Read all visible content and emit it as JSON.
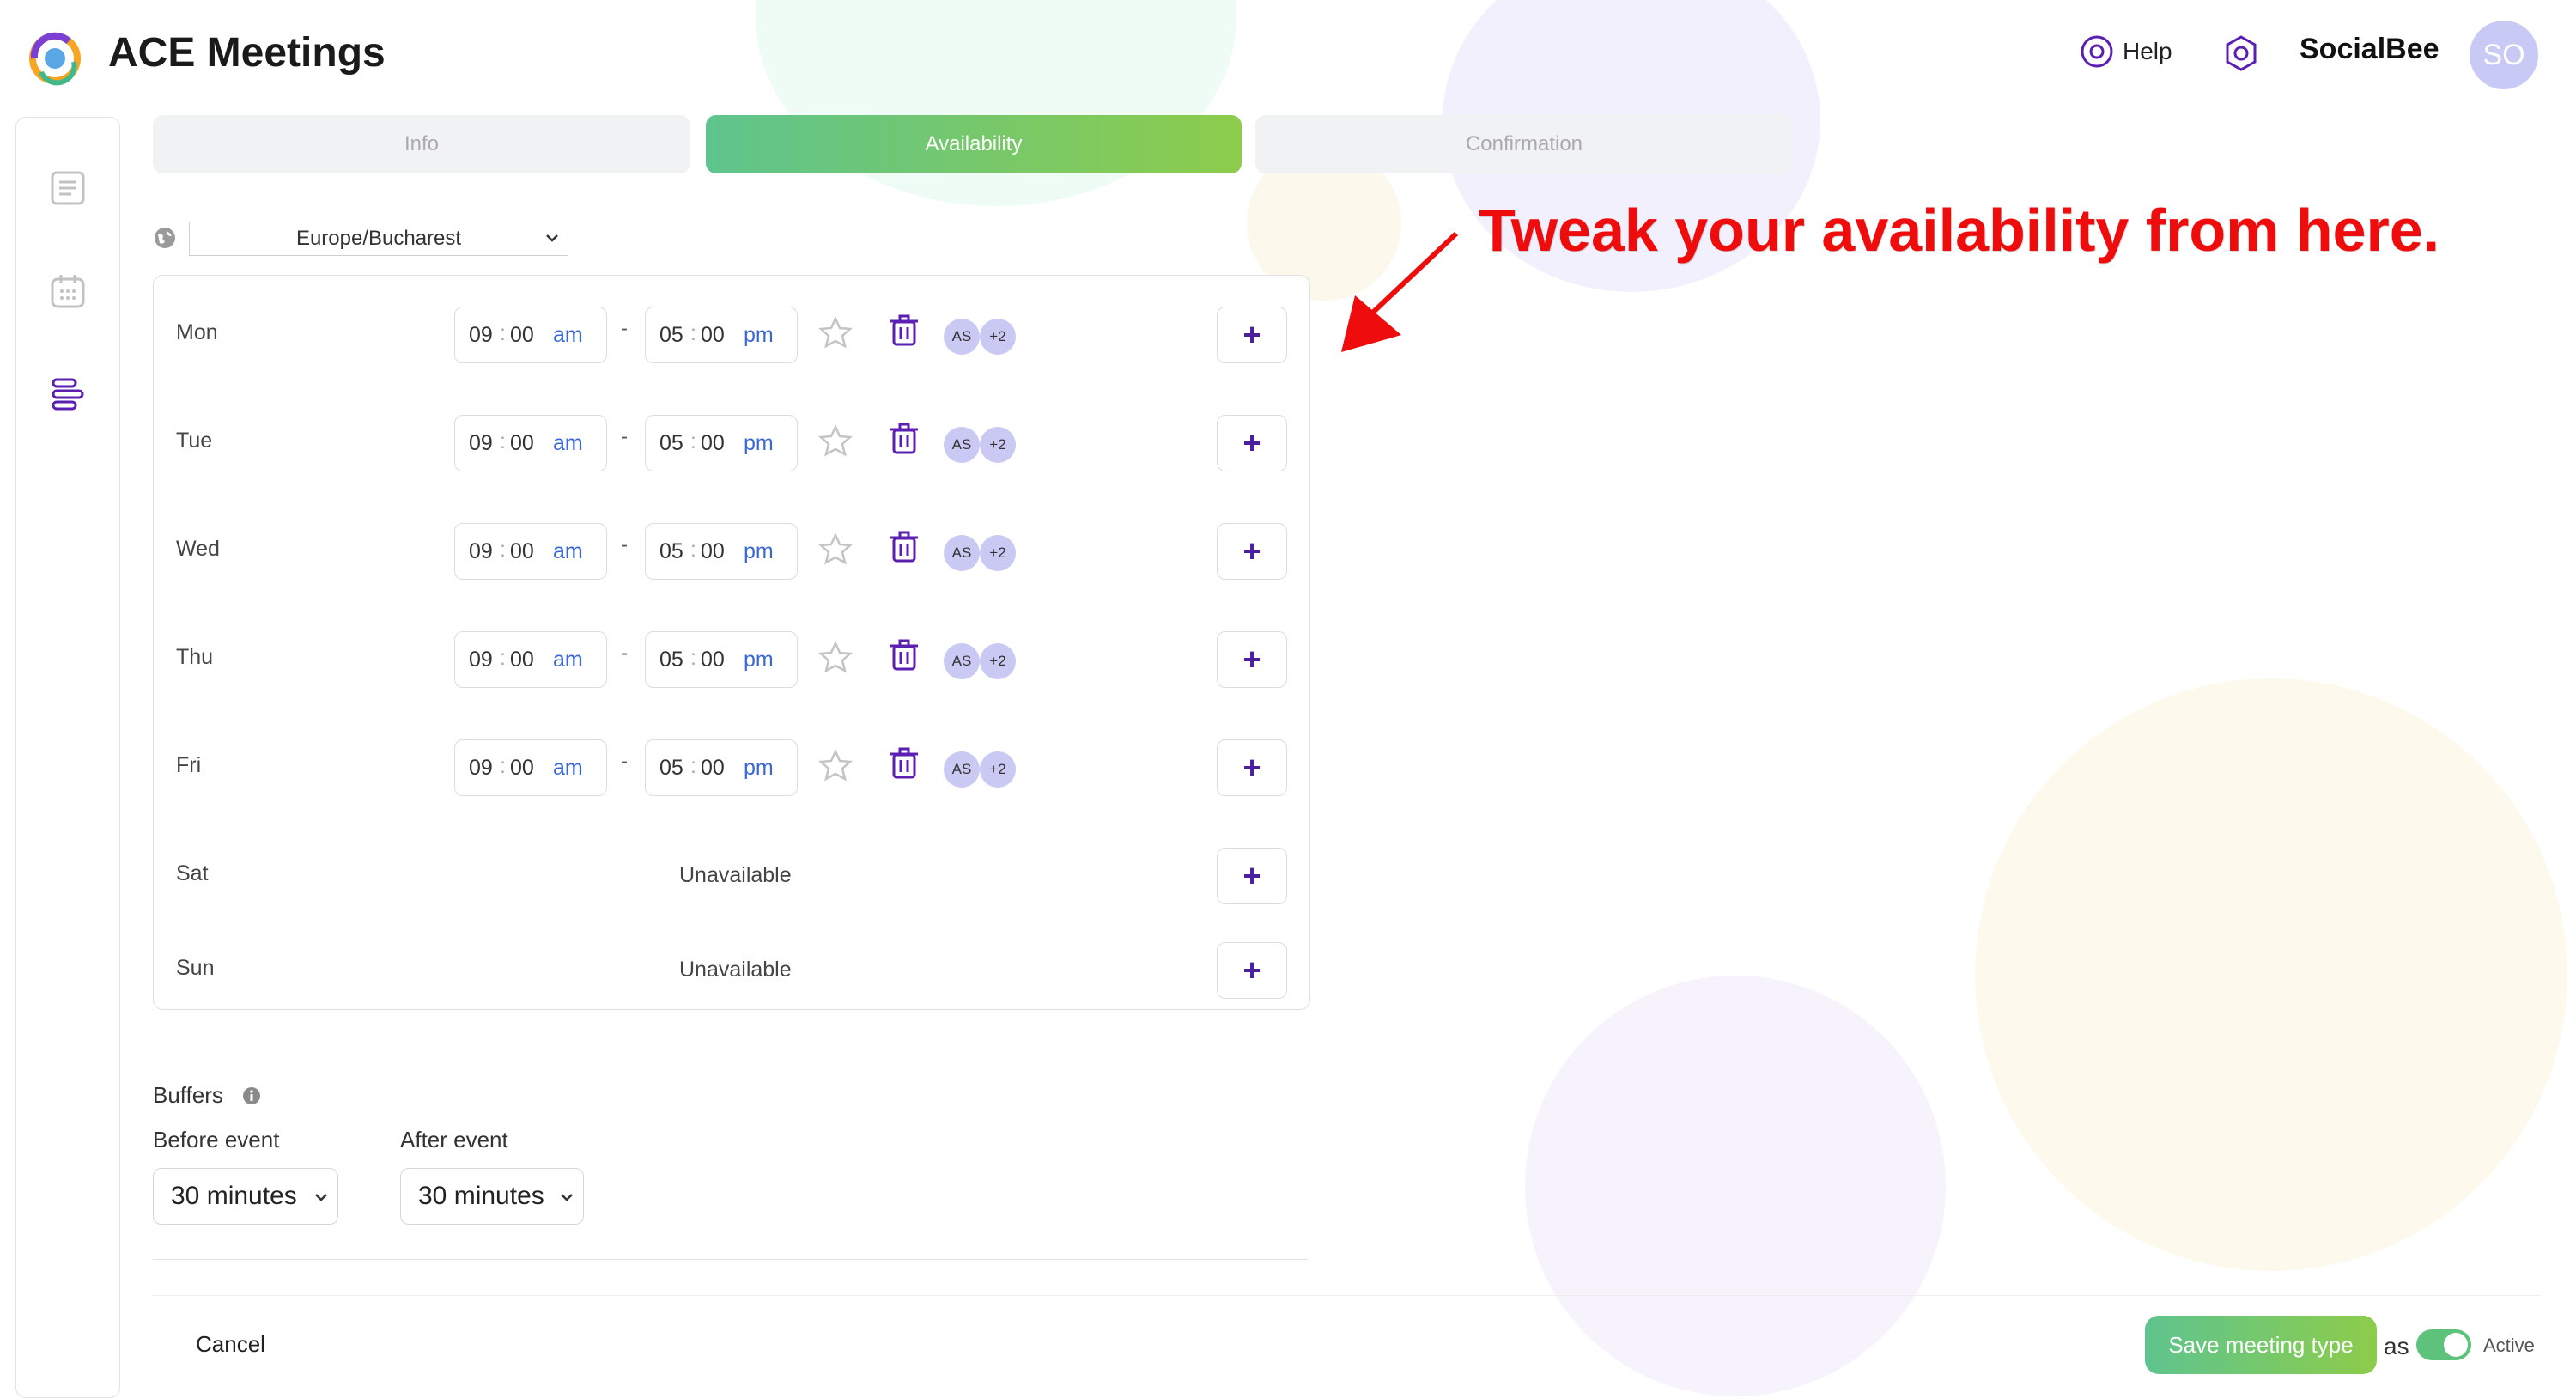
{
  "header": {
    "title": "ACE Meetings",
    "help_label": "Help",
    "brand": "SocialBee",
    "avatar_initials": "SO"
  },
  "tabs": [
    {
      "label": "Info",
      "active": false
    },
    {
      "label": "Availability",
      "active": true
    },
    {
      "label": "Confirmation",
      "active": false
    }
  ],
  "timezone": {
    "value": "Europe/Bucharest"
  },
  "schedule": [
    {
      "day": "Mon",
      "start_h": "09",
      "start_m": "00",
      "start_ap": "am",
      "end_h": "05",
      "end_m": "00",
      "end_ap": "pm",
      "chip1": "AS",
      "chip2": "+2",
      "dash": "-"
    },
    {
      "day": "Tue",
      "start_h": "09",
      "start_m": "00",
      "start_ap": "am",
      "end_h": "05",
      "end_m": "00",
      "end_ap": "pm",
      "chip1": "AS",
      "chip2": "+2",
      "dash": "-"
    },
    {
      "day": "Wed",
      "start_h": "09",
      "start_m": "00",
      "start_ap": "am",
      "end_h": "05",
      "end_m": "00",
      "end_ap": "pm",
      "chip1": "AS",
      "chip2": "+2",
      "dash": "-"
    },
    {
      "day": "Thu",
      "start_h": "09",
      "start_m": "00",
      "start_ap": "am",
      "end_h": "05",
      "end_m": "00",
      "end_ap": "pm",
      "chip1": "AS",
      "chip2": "+2",
      "dash": "-"
    },
    {
      "day": "Fri",
      "start_h": "09",
      "start_m": "00",
      "start_ap": "am",
      "end_h": "05",
      "end_m": "00",
      "end_ap": "pm",
      "chip1": "AS",
      "chip2": "+2",
      "dash": "-"
    },
    {
      "day": "Sat",
      "status": "Unavailable"
    },
    {
      "day": "Sun",
      "status": "Unavailable"
    }
  ],
  "plus_symbol": "+",
  "annotation": {
    "text": "Tweak your availability from here."
  },
  "buffers": {
    "title": "Buffers",
    "before_label": "Before event",
    "before_value": "30 minutes",
    "after_label": "After event",
    "after_value": "30 minutes"
  },
  "footer": {
    "cancel_label": "Cancel",
    "save_label": "Save meeting type",
    "as_text": "as",
    "status_label": "Active",
    "toggle_on": true
  },
  "colors": {
    "accent_green": "#5ec48e",
    "accent_lime": "#8dcc4b",
    "purple": "#4b1fa0",
    "annotation_red": "#ee0c0c",
    "chip": "#c9c9f4"
  },
  "icons": [
    "logo-icon",
    "help-icon",
    "gear-icon",
    "list-icon",
    "calendar-icon",
    "availability-icon",
    "globe-icon",
    "star-icon",
    "trash-icon",
    "info-icon",
    "chevron-down-icon",
    "arrow-icon"
  ]
}
